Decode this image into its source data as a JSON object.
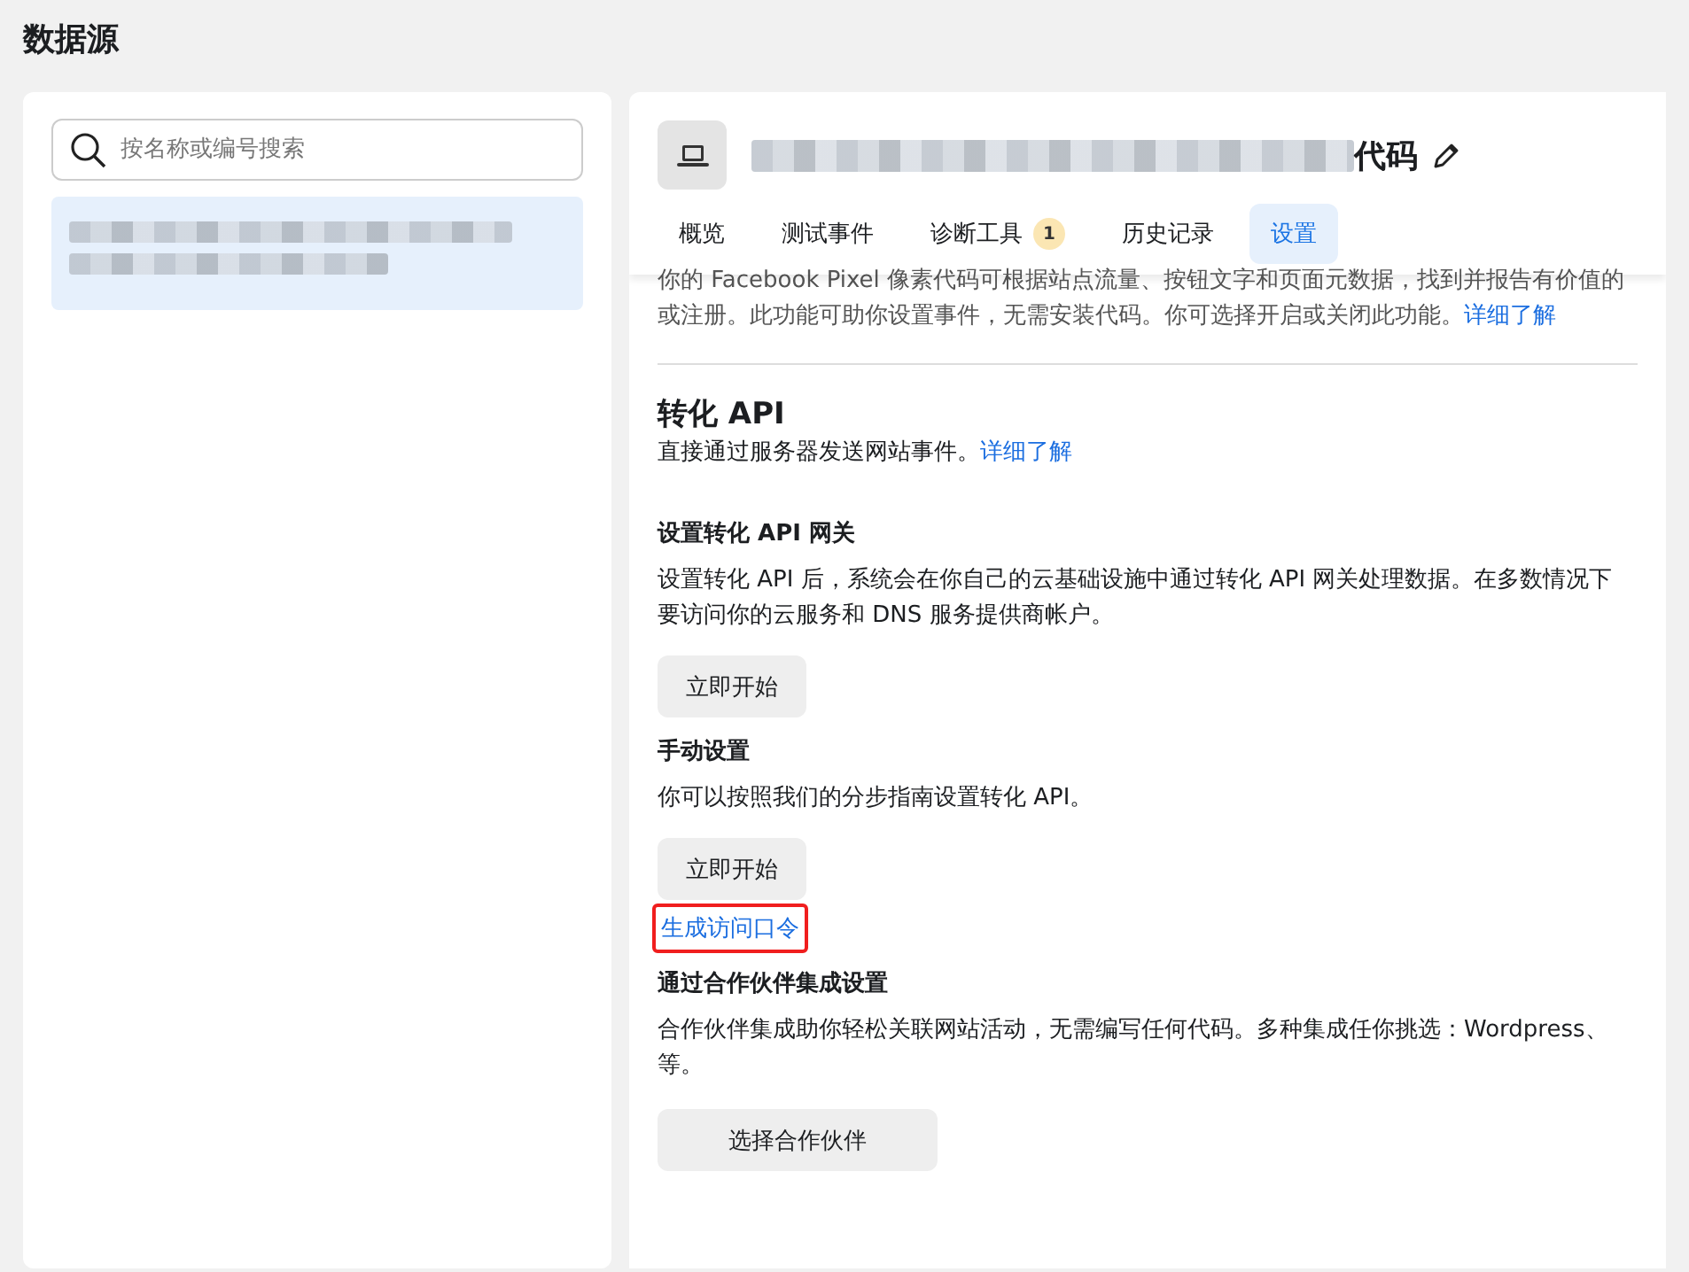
{
  "page_title": "数据源",
  "sidebar": {
    "search": {
      "placeholder": "按名称或编号搜索"
    },
    "items": [
      {
        "label_redacted": true,
        "selected": true
      }
    ]
  },
  "header": {
    "title_redacted": true,
    "title": "代码",
    "tabs": [
      {
        "label": "概览",
        "selected": false
      },
      {
        "label": "测试事件",
        "selected": false
      },
      {
        "label": "诊断工具",
        "selected": false,
        "badge": "1"
      },
      {
        "label": "历史记录",
        "selected": false
      },
      {
        "label": "设置",
        "selected": true
      }
    ]
  },
  "intro": {
    "lines": [
      "你的 Facebook Pixel 像素代码可根据站点流量、按钮文字和页面元数据，找到并报告有价值的",
      "或注册。此功能可助你设置事件，无需安装代码。你可选择开启或关闭此功能。"
    ],
    "link": "详细了解"
  },
  "section": {
    "title": "转化 API",
    "description": "直接通过服务器发送网站事件。",
    "link": "详细了解",
    "blocks": [
      {
        "kind": "button",
        "heading": "设置转化 API 网关",
        "lines": [
          "设置转化 API 后，系统会在你自己的云基础设施中通过转化 API 网关处理数据。在多数情况下",
          "要访问你的云服务和 DNS 服务提供商帐户。"
        ],
        "button": "立即开始"
      },
      {
        "kind": "button",
        "heading": "手动设置",
        "lines": [
          "你可以按照我们的分步指南设置转化 API。"
        ],
        "button": "立即开始",
        "link": "生成访问口令",
        "link_highlighted": true
      },
      {
        "kind": "wide-button",
        "heading": "通过合作伙伴集成设置",
        "lines": [
          "合作伙伴集成助你轻松关联网站活动，无需编写任何代码。多种集成任你挑选：Wordpress、",
          "等。"
        ],
        "button": "选择合作伙伴"
      }
    ]
  }
}
